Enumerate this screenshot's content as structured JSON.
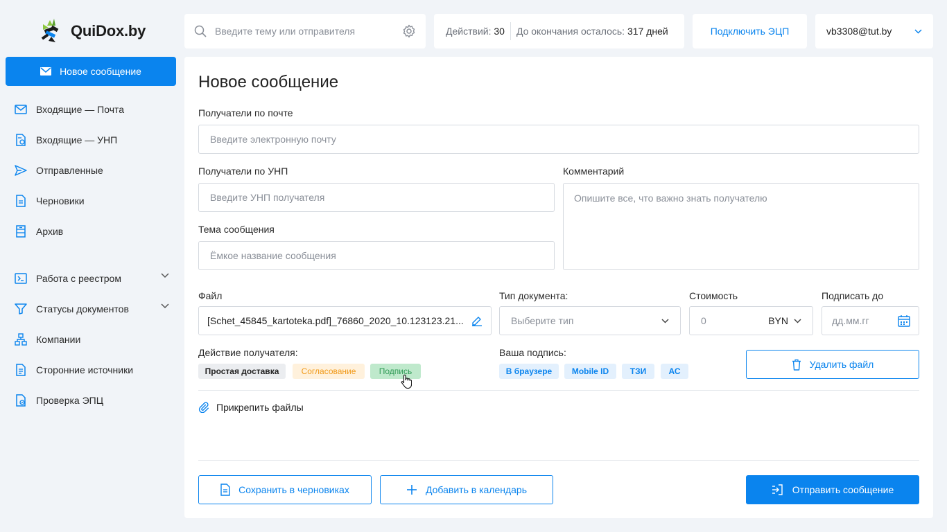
{
  "brand": {
    "name": "QuiDox.by"
  },
  "sidebar": {
    "new_message": "Новое сообщение",
    "items": [
      {
        "label": "Входящие — Почта"
      },
      {
        "label": "Входящие — УНП"
      },
      {
        "label": "Отправленные"
      },
      {
        "label": "Черновики"
      },
      {
        "label": "Архив"
      },
      {
        "label": "Работа с реестром"
      },
      {
        "label": "Статусы документов"
      },
      {
        "label": "Компании"
      },
      {
        "label": "Сторонние источники"
      },
      {
        "label": "Проверка ЭПЦ"
      }
    ]
  },
  "topbar": {
    "search_placeholder": "Введите тему или отправителя",
    "actions_label": "Действий:",
    "actions_value": "30",
    "remaining_label": "До окончания осталось:",
    "remaining_value": "317 дней",
    "connect_ecp": "Подключить ЭЦП",
    "user_email": "vb3308@tut.by"
  },
  "form": {
    "title": "Новое сообщение",
    "email_label": "Получатели по почте",
    "email_placeholder": "Введите электронную почту",
    "unp_label": "Получатели по УНП",
    "unp_placeholder": "Введите УНП получателя",
    "comment_label": "Комментарий",
    "comment_placeholder": "Опишите все, что важно знать получателю",
    "subject_label": "Тема сообщения",
    "subject_placeholder": "Ёмкое название сообщения",
    "file_label": "Файл",
    "file_value": "[Schet_45845_kartoteka.pdf]_76860_2020_10.123123.21...",
    "doctype_label": "Тип документа:",
    "doctype_placeholder": "Выберите тип",
    "cost_label": "Стоимость",
    "cost_value": "0",
    "currency": "BYN",
    "sign_by_label": "Подписать до",
    "sign_by_placeholder": "дд.мм.гг",
    "recipient_action_label": "Действие получателя:",
    "actions": [
      "Простая доставка",
      "Согласование",
      "Подпись"
    ],
    "signature_label": "Ваша подпись:",
    "signatures": [
      "В браузере",
      "Mobile ID",
      "ТЗИ",
      "АС"
    ],
    "delete_file": "Удалить файл",
    "attach_files": "Прикрепить файлы",
    "save_draft": "Сохранить в черновиках",
    "add_calendar": "Добавить в календарь",
    "send": "Отправить сообщение"
  },
  "colors": {
    "accent": "#0a84ee",
    "background": "#f1f4f8"
  }
}
